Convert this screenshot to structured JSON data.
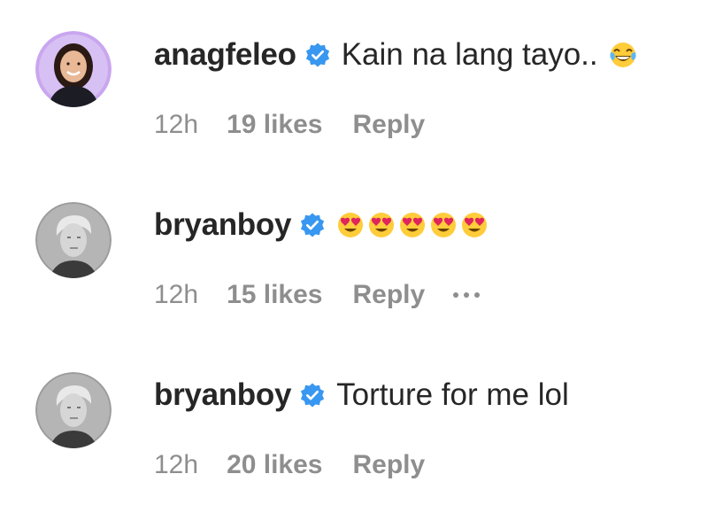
{
  "comments": [
    {
      "username": "anagfeleo",
      "text": "Kain na lang tayo..",
      "emoji": "tears-of-joy-emoji",
      "time": "12h",
      "likes": "19 likes",
      "reply": "Reply",
      "verified": true
    },
    {
      "username": "bryanboy",
      "text": "",
      "emoji": "heart-eyes-emoji",
      "emoji_count": 5,
      "time": "12h",
      "likes": "15 likes",
      "reply": "Reply",
      "more_options": "more-options-icon",
      "verified": true
    },
    {
      "username": "bryanboy",
      "text": "Torture for me lol",
      "time": "12h",
      "likes": "20 likes",
      "reply": "Reply",
      "verified": true
    }
  ],
  "colors": {
    "primary_text": "#262626",
    "secondary_text": "#8e8e8e",
    "verified_badge": "#3897f0",
    "avatar_ring_purple": "#b79ae6"
  }
}
